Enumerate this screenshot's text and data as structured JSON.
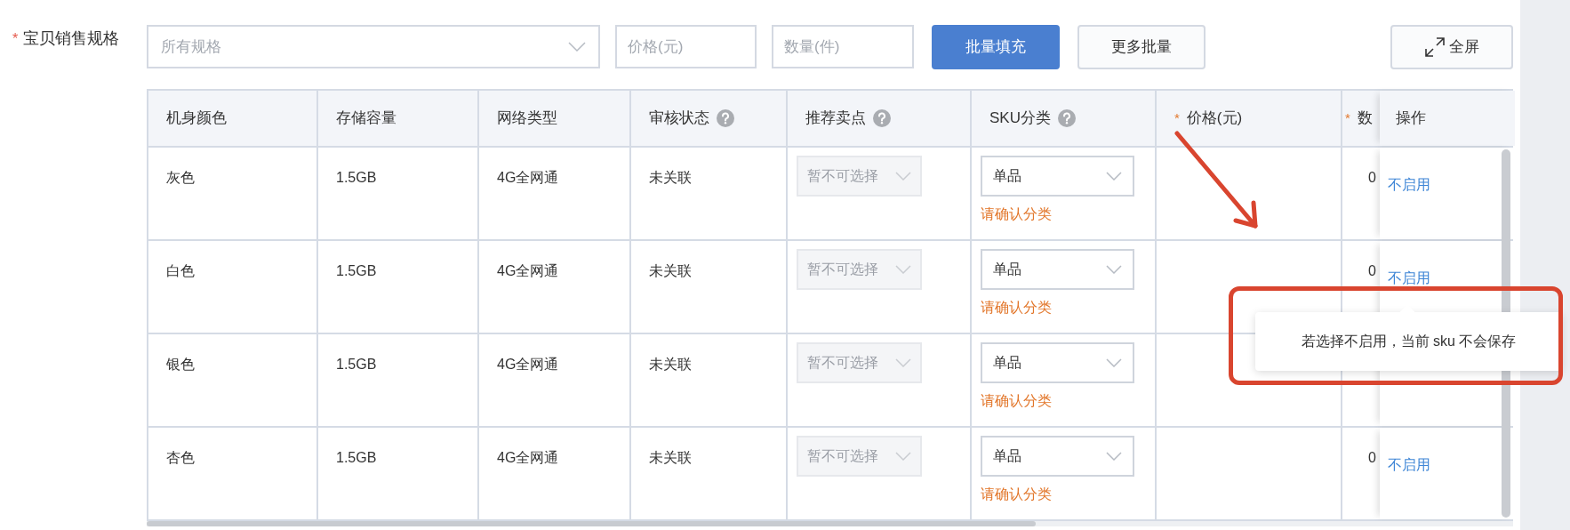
{
  "spec_label": {
    "marker": "*",
    "text": "宝贝销售规格"
  },
  "toolbar": {
    "spec_select": {
      "placeholder": "所有规格"
    },
    "price_field": {
      "placeholder": "价格(元)"
    },
    "quantity_field": {
      "placeholder": "数量(件)"
    },
    "buttons": [
      {
        "label": "批量填充",
        "kind": "primary"
      },
      {
        "label": "更多批量",
        "kind": "default"
      }
    ],
    "fullscreen_button": {
      "label": "全屏"
    }
  },
  "table": {
    "columns": [
      {
        "label": "机身颜色",
        "help": false
      },
      {
        "label": "存储容量",
        "help": false
      },
      {
        "label": "网络类型",
        "help": false
      },
      {
        "label": "审核状态",
        "help": true
      },
      {
        "label": "推荐卖点",
        "help": true
      },
      {
        "label": "SKU分类",
        "help": true
      },
      {
        "marker": "*",
        "label": "价格(元)",
        "help": false
      },
      {
        "marker": "*",
        "label": "数"
      },
      {
        "label": "操作",
        "help": false
      }
    ],
    "rows": [
      {
        "variant": "灰色",
        "storage": "1.5GB",
        "network": "4G全网通",
        "review_status": "未关联",
        "selling_point": {
          "placeholder": "暂不可选择",
          "disabled": true
        },
        "sku_type": {
          "value": "单品",
          "hint": "请确认分类"
        },
        "quantity": "0",
        "action": "不启用"
      },
      {
        "variant": "白色",
        "storage": "1.5GB",
        "network": "4G全网通",
        "review_status": "未关联",
        "selling_point": {
          "placeholder": "暂不可选择",
          "disabled": true
        },
        "sku_type": {
          "value": "单品",
          "hint": "请确认分类"
        },
        "quantity": "0",
        "action": "不启用"
      },
      {
        "variant": "银色",
        "storage": "1.5GB",
        "network": "4G全网通",
        "review_status": "未关联",
        "selling_point": {
          "placeholder": "暂不可选择",
          "disabled": true
        },
        "sku_type": {
          "value": "单品",
          "hint": "请确认分类"
        }
      },
      {
        "variant": "杏色",
        "storage": "1.5GB",
        "network": "4G全网通",
        "review_status": "未关联",
        "selling_point": {
          "placeholder": "暂不可选择",
          "disabled": true
        },
        "sku_type": {
          "value": "单品",
          "hint": "请确认分类"
        },
        "quantity": "0",
        "action": "不启用"
      }
    ]
  },
  "tooltip": {
    "text": "若选择不启用，当前 sku 不会保存"
  }
}
